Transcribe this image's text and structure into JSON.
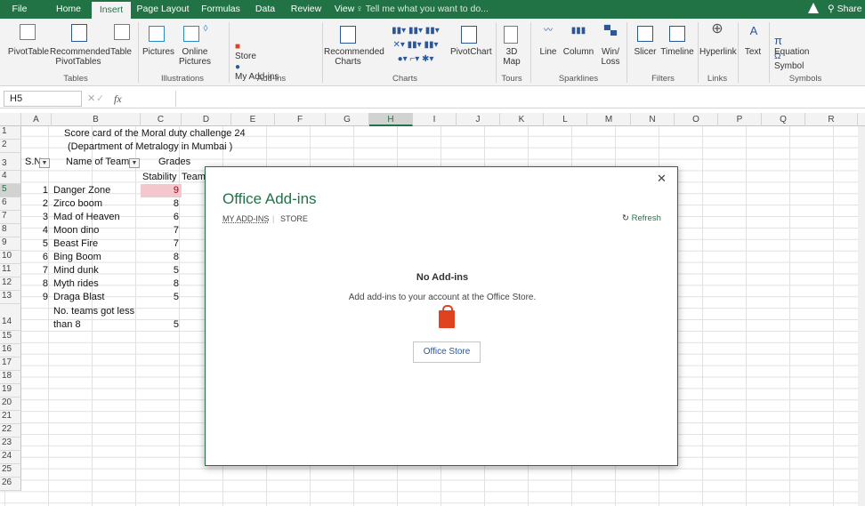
{
  "tabs": [
    "File",
    "Home",
    "Insert",
    "Page Layout",
    "Formulas",
    "Data",
    "Review",
    "View"
  ],
  "tellme": "Tell me what you want to do...",
  "share": "Share",
  "ribbon": {
    "buttons": {
      "pivottable": "PivotTable",
      "recommended_pivottables": "Recommended\nPivotTables",
      "table": "Table",
      "pictures": "Pictures",
      "online_pictures": "Online\nPictures",
      "store": "Store",
      "my_addins": "My Add-ins",
      "recommended_charts": "Recommended\nCharts",
      "pivotchart": "PivotChart",
      "map3d": "3D\nMap",
      "line": "Line",
      "column": "Column",
      "winloss": "Win/\nLoss",
      "slicer": "Slicer",
      "timeline": "Timeline",
      "hyperlink": "Hyperlink",
      "text": "Text",
      "equation": "Equation",
      "symbol": "Symbol"
    },
    "groups": [
      "Tables",
      "Illustrations",
      "Add-ins",
      "Charts",
      "Tours",
      "Sparklines",
      "Filters",
      "Links",
      "Symbols"
    ]
  },
  "formula": {
    "namebox": "H5",
    "value": ""
  },
  "columns": [
    "A",
    "B",
    "C",
    "D",
    "E",
    "F",
    "G",
    "H",
    "I",
    "J",
    "K",
    "L",
    "M",
    "N",
    "O",
    "P",
    "Q",
    "R"
  ],
  "selected_column": "H",
  "rows": [
    "1",
    "2",
    "3",
    "4",
    "5",
    "6",
    "7",
    "8",
    "9",
    "10",
    "11",
    "12",
    "13",
    "14",
    "15",
    "16",
    "17",
    "18",
    "19",
    "20",
    "21",
    "22",
    "23",
    "24",
    "25",
    "26"
  ],
  "selected_row": "5",
  "sheet": {
    "title1": "Score card of the Moral duty challenge 24",
    "title2": "(Department of Metralogy in Mumbai )",
    "hdr_sn": "S.N",
    "hdr_team": "Name of Team",
    "hdr_grades": "Grades",
    "hdr_stability": "Stability",
    "hdr_team2": "Team",
    "teams": [
      {
        "n": "1",
        "name": "Danger Zone",
        "score": "9"
      },
      {
        "n": "2",
        "name": "Zirco boom",
        "score": "8"
      },
      {
        "n": "3",
        "name": "Mad of Heaven",
        "score": "6"
      },
      {
        "n": "4",
        "name": "Moon dino",
        "score": "7"
      },
      {
        "n": "5",
        "name": "Beast Fire",
        "score": "7"
      },
      {
        "n": "6",
        "name": "Bing Boom",
        "score": "8"
      },
      {
        "n": "7",
        "name": "Mind dunk",
        "score": "5"
      },
      {
        "n": "8",
        "name": "Myth rides",
        "score": "8"
      },
      {
        "n": "9",
        "name": "Draga Blast",
        "score": "5"
      }
    ],
    "summary_label1": "No. teams got less",
    "summary_label2": "than 8",
    "summary_value": "5",
    "highlight_color": "#f4c7ce"
  },
  "dialog": {
    "title": "Office Add-ins",
    "tab_myaddins": "MY ADD-INS",
    "tab_store": "STORE",
    "refresh": "Refresh",
    "no_addins": "No Add-ins",
    "message": "Add add-ins to your account at the Office Store.",
    "store_button": "Office Store",
    "accent": "#217346"
  }
}
